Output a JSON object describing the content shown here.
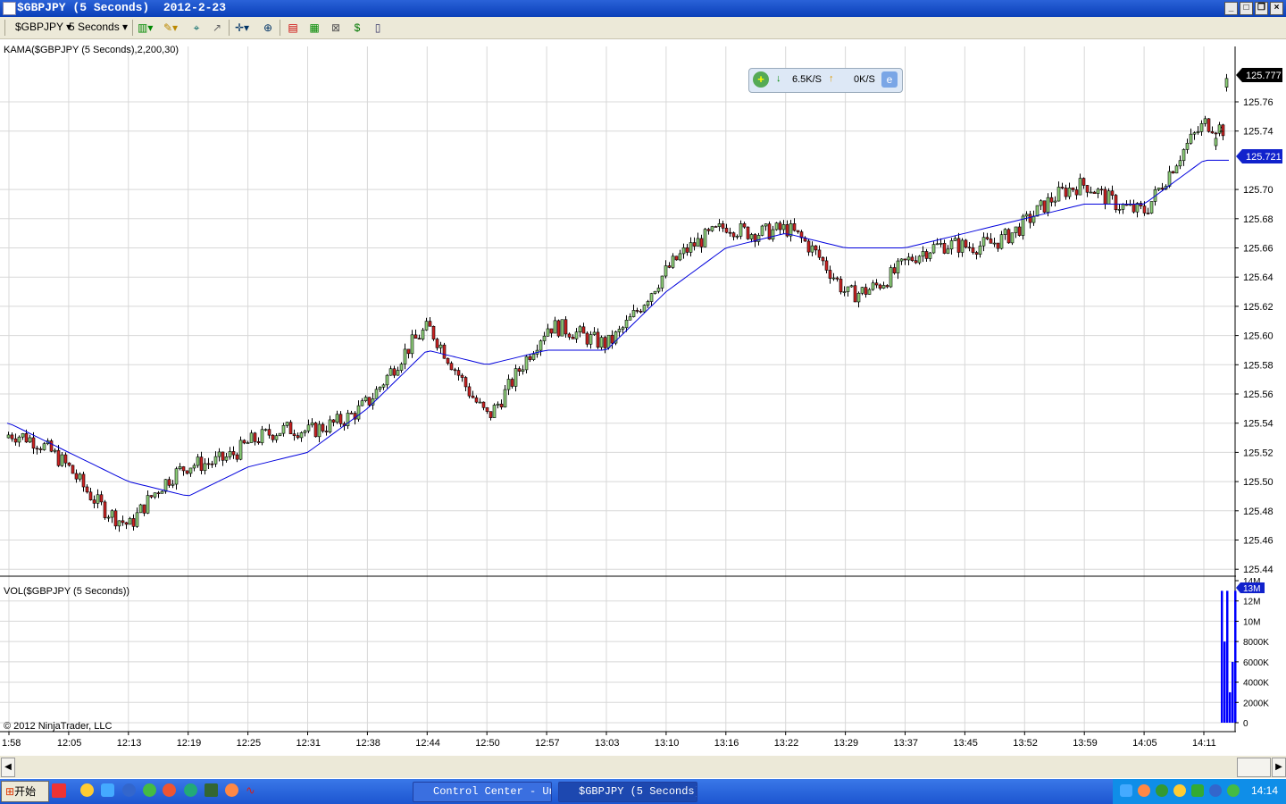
{
  "window": {
    "title": "$GBPJPY (5 Seconds)  2012-2-23",
    "controls": [
      "minimize",
      "restore",
      "close"
    ]
  },
  "toolbar": {
    "instrument": "$GBPJPY",
    "interval": "5 Seconds",
    "icons": [
      "bar-type-icon",
      "pencil-draw-icon",
      "pin-icon",
      "cursor-icon",
      "crosshair-icon",
      "zoom-icon",
      "chart-trader-icon",
      "strategy-icon",
      "data-box-icon",
      "dollar-icon",
      "properties-icon"
    ]
  },
  "chart": {
    "price_panel_label": "KAMA($GBPJPY (5 Seconds),2,200,30)",
    "volume_panel_label": "VOL($GBPJPY (5 Seconds))",
    "copyright": "© 2012 NinjaTrader, LLC",
    "current_price": "125.777",
    "kama_value": "125.721",
    "volume_value": "13M",
    "price_ticks": [
      "125.76",
      "125.74",
      "125.70",
      "125.68",
      "125.66",
      "125.64",
      "125.62",
      "125.60",
      "125.58",
      "125.56",
      "125.54",
      "125.52",
      "125.50",
      "125.48",
      "125.46",
      "125.44"
    ],
    "volume_ticks": [
      "14M",
      "12M",
      "10M",
      "8000K",
      "6000K",
      "4000K",
      "2000K",
      "0"
    ],
    "time_ticks": [
      "1:58",
      "12:05",
      "12:13",
      "12:19",
      "12:25",
      "12:31",
      "12:38",
      "12:44",
      "12:50",
      "12:57",
      "13:03",
      "13:10",
      "13:16",
      "13:22",
      "13:29",
      "13:37",
      "13:45",
      "13:52",
      "13:59",
      "14:05",
      "14:11"
    ],
    "colors": {
      "up": "#8fd17a",
      "down": "#cc2222",
      "kama": "#0000dd",
      "volume": "#0000ff",
      "grid": "#d8d8d8"
    }
  },
  "chart_data": {
    "type": "line",
    "title": "",
    "xlabel": "",
    "ylabel": "",
    "ylim": [
      125.44,
      125.78
    ],
    "x": [
      "1:58",
      "12:05",
      "12:13",
      "12:19",
      "12:25",
      "12:31",
      "12:38",
      "12:44",
      "12:50",
      "12:57",
      "13:03",
      "13:10",
      "13:16",
      "13:22",
      "13:29",
      "13:37",
      "13:45",
      "13:52",
      "13:59",
      "14:05",
      "14:11"
    ],
    "series": [
      {
        "name": "",
        "role": "price",
        "values": [
          125.53,
          125.51,
          125.47,
          125.51,
          125.53,
          125.53,
          125.56,
          125.6,
          125.55,
          125.6,
          125.6,
          125.64,
          125.68,
          125.67,
          125.63,
          125.65,
          125.66,
          125.68,
          125.7,
          125.69,
          125.74
        ]
      },
      {
        "name": "KAMA($GBPJPY (5 Seconds),2,200,30)",
        "role": "kama",
        "values": [
          125.54,
          125.52,
          125.5,
          125.49,
          125.51,
          125.52,
          125.55,
          125.59,
          125.58,
          125.59,
          125.59,
          125.63,
          125.66,
          125.67,
          125.66,
          125.66,
          125.67,
          125.68,
          125.69,
          125.69,
          125.72
        ]
      }
    ],
    "volume": {
      "name": "VOL($GBPJPY (5 Seconds))",
      "recent_values": [
        13000000,
        8000000,
        13000000,
        3000000,
        6000000,
        13000000
      ]
    },
    "grid": true
  },
  "speed_widget": {
    "down_rate": "6.5K/S",
    "up_rate": "0K/S"
  },
  "taskbar": {
    "start_label": "开始",
    "tasks": [
      {
        "label": "Control Center - Un...",
        "active": false
      },
      {
        "label": "$GBPJPY (5 Seconds)...",
        "active": true
      }
    ],
    "clock": "14:14"
  }
}
